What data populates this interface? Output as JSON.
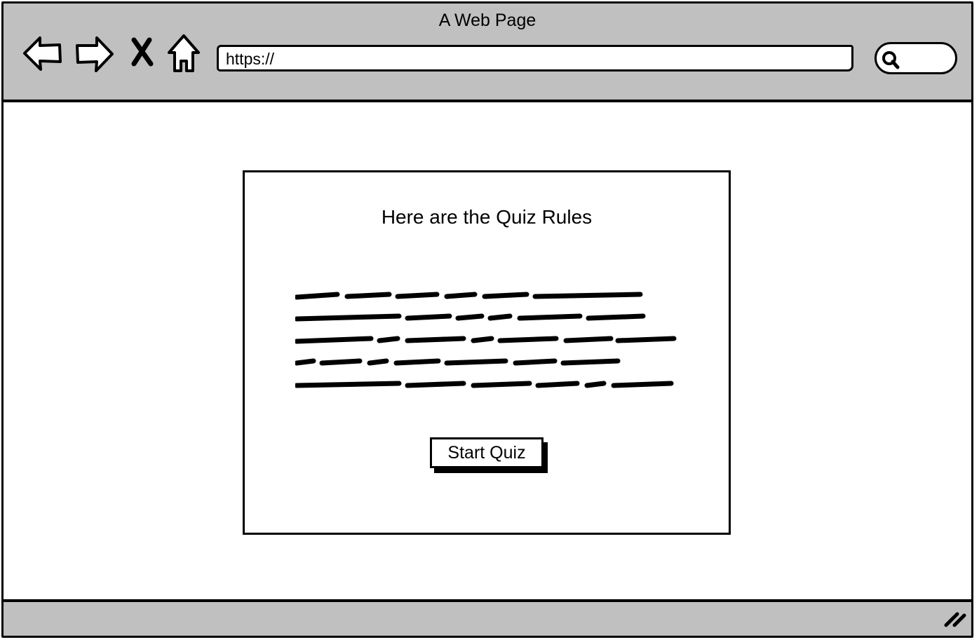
{
  "window": {
    "title": "A Web Page"
  },
  "toolbar": {
    "icons": [
      "back-arrow-icon",
      "forward-arrow-icon",
      "close-x-icon",
      "home-icon"
    ],
    "url": "https://",
    "search_icon": "search-icon"
  },
  "quiz": {
    "title": "Here are the Quiz Rules",
    "start_label": "Start Quiz"
  },
  "colors": {
    "chrome": "#c0c0c0",
    "ink": "#000000",
    "page": "#ffffff"
  }
}
